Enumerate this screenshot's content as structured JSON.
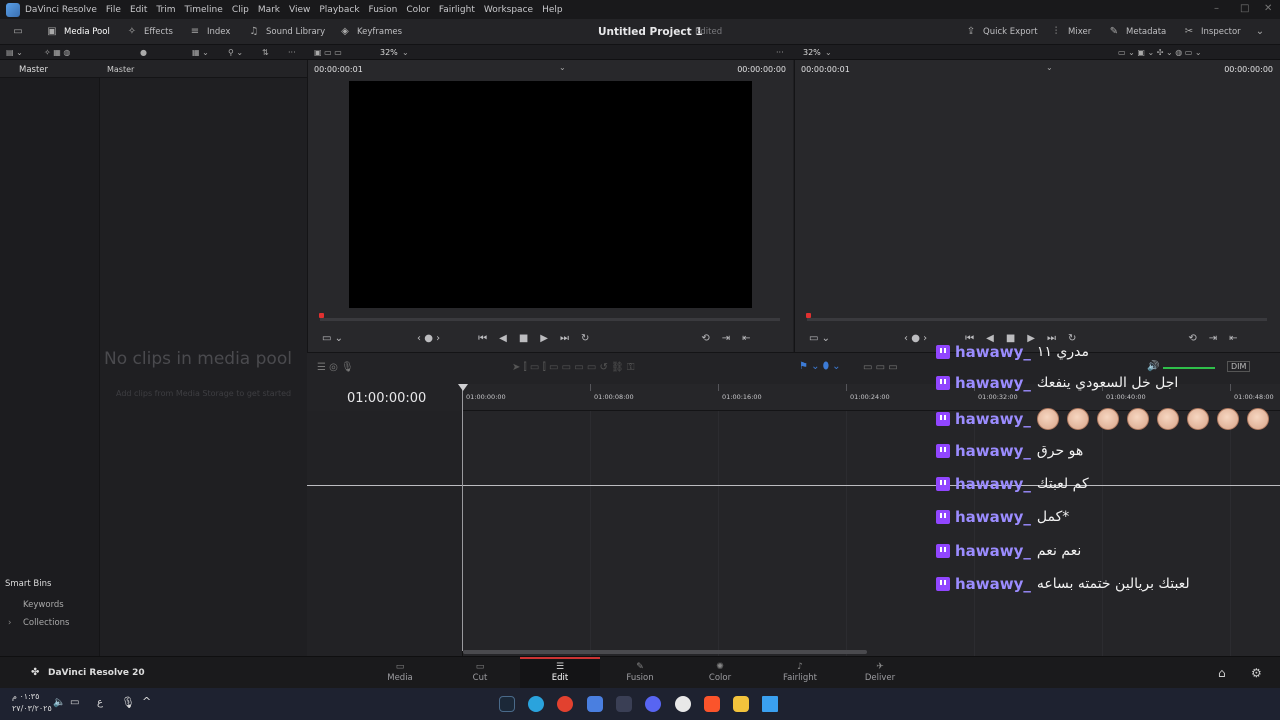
{
  "menu": {
    "items": [
      "DaVinci Resolve",
      "File",
      "Edit",
      "Trim",
      "Timeline",
      "Clip",
      "Mark",
      "View",
      "Playback",
      "Fusion",
      "Color",
      "Fairlight",
      "Workspace",
      "Help"
    ]
  },
  "toolbar": {
    "media_pool": "Media Pool",
    "effects": "Effects",
    "index": "Index",
    "sound_library": "Sound Library",
    "keyframes": "Keyframes",
    "project_title": "Untitled Project 1",
    "project_status": "Edited",
    "quick_export": "Quick Export",
    "mixer": "Mixer",
    "metadata": "Metadata",
    "inspector": "Inspector"
  },
  "subtool": {
    "zoom_source": "32%",
    "zoom_program": "32%"
  },
  "bins": {
    "master_left": "Master",
    "master_pool": "Master",
    "smart_bins": "Smart Bins",
    "keywords": "Keywords",
    "collections": "Collections"
  },
  "media_pool": {
    "empty_title": "No clips in media pool",
    "empty_hint": "Add clips from Media Storage to get started"
  },
  "source_viewer": {
    "tc_left": "00:00:00:01",
    "tc_right": "00:00:00:00"
  },
  "program_viewer": {
    "tc_left": "00:00:00:01",
    "tc_right": "00:00:00:00"
  },
  "timeline": {
    "timecode": "01:00:00:00",
    "ruler": [
      "01:00:00:00",
      "01:00:08:00",
      "01:00:16:00",
      "01:00:24:00",
      "01:00:32:00",
      "01:00:40:00",
      "01:00:48:00"
    ],
    "dim": "DIM"
  },
  "pages": [
    {
      "label": "Media",
      "icon": "media-icon"
    },
    {
      "label": "Cut",
      "icon": "cut-icon"
    },
    {
      "label": "Edit",
      "icon": "edit-icon"
    },
    {
      "label": "Fusion",
      "icon": "fusion-icon"
    },
    {
      "label": "Color",
      "icon": "color-icon"
    },
    {
      "label": "Fairlight",
      "icon": "fairlight-icon"
    },
    {
      "label": "Deliver",
      "icon": "deliver-icon"
    }
  ],
  "brand": "DaVinci Resolve 20",
  "taskbar": {
    "time": "٠١:٣٥ م",
    "date": "٢٧/٠٣/٢٠٢٥",
    "lang": "ع"
  },
  "chat": [
    {
      "user": "hawawy_",
      "msg": "مدري ١١"
    },
    {
      "user": "hawawy_",
      "msg": "اجل خل السعودي ينفعك"
    },
    {
      "user": "hawawy_",
      "msg": ""
    },
    {
      "user": "hawawy_",
      "msg": "هو حرق"
    },
    {
      "user": "hawawy_",
      "msg": "كم لعبتك"
    },
    {
      "user": "hawawy_",
      "msg": "*كمل"
    },
    {
      "user": "hawawy_",
      "msg": "نعم نعم"
    },
    {
      "user": "hawawy_",
      "msg": "لعبتك بريالين ختمته بساعه"
    }
  ],
  "colors": {
    "twitch": "#9146ff",
    "username": "#9b8cff",
    "playhead": "#e03030",
    "accent": "#c33333"
  }
}
